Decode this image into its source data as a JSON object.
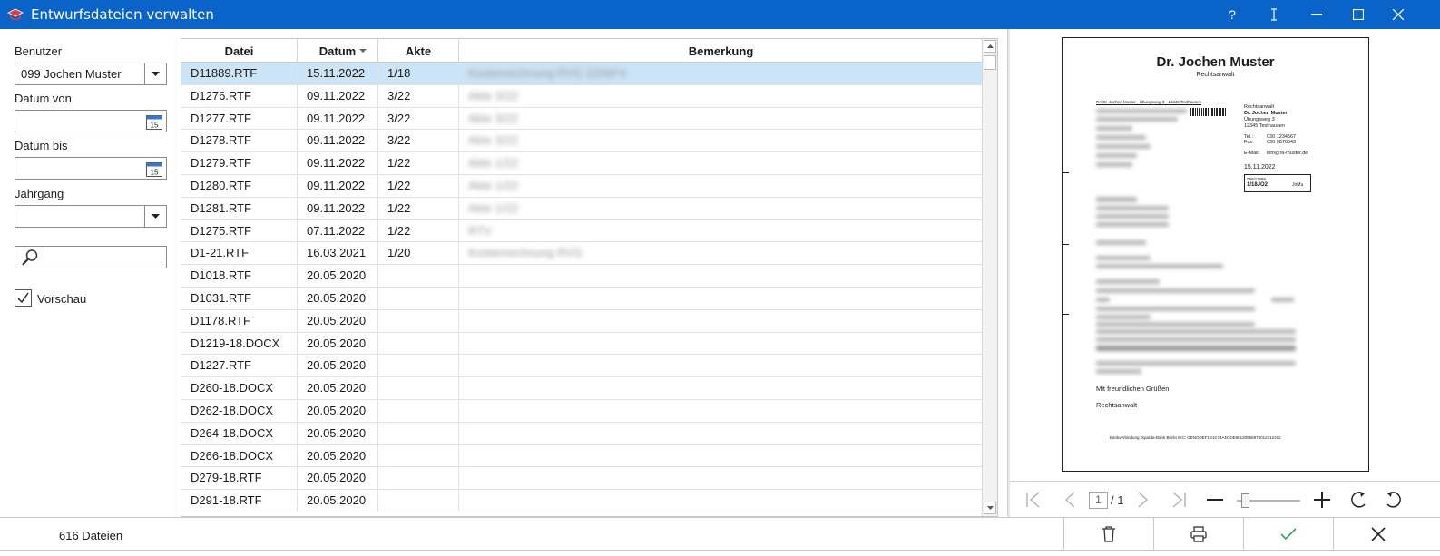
{
  "window": {
    "title": "Entwurfsdateien verwalten",
    "controls": {
      "help": "?",
      "cursor_icon": "text-cursor-icon",
      "minimize": "minimize-icon",
      "maximize": "maximize-icon",
      "close": "close-icon"
    }
  },
  "filters": {
    "user_label": "Benutzer",
    "user_value": "099 Jochen Muster",
    "date_from_label": "Datum von",
    "date_from_value": "",
    "date_to_label": "Datum bis",
    "date_to_value": "",
    "year_label": "Jahrgang",
    "year_value": "",
    "search_value": "",
    "preview_label": "Vorschau",
    "preview_checked": true
  },
  "grid": {
    "columns": [
      "Datei",
      "Datum",
      "Akte",
      "Bemerkung"
    ],
    "sort_column": "Datum",
    "sort_direction": "descending",
    "rows": [
      {
        "file": "D11889.RTF",
        "date": "15.11.2022",
        "akte": "1/18",
        "remark": "Kostenrechnung RVG 2206F4",
        "selected": true
      },
      {
        "file": "D1276.RTF",
        "date": "09.11.2022",
        "akte": "3/22",
        "remark": "Akte 3/22"
      },
      {
        "file": "D1277.RTF",
        "date": "09.11.2022",
        "akte": "3/22",
        "remark": "Akte 3/22"
      },
      {
        "file": "D1278.RTF",
        "date": "09.11.2022",
        "akte": "3/22",
        "remark": "Akte 3/22"
      },
      {
        "file": "D1279.RTF",
        "date": "09.11.2022",
        "akte": "1/22",
        "remark": "Akte 1/22"
      },
      {
        "file": "D1280.RTF",
        "date": "09.11.2022",
        "akte": "1/22",
        "remark": "Akte 1/22"
      },
      {
        "file": "D1281.RTF",
        "date": "09.11.2022",
        "akte": "1/22",
        "remark": "Akte 1/22"
      },
      {
        "file": "D1275.RTF",
        "date": "07.11.2022",
        "akte": "1/22",
        "remark": "RTV"
      },
      {
        "file": "D1-21.RTF",
        "date": "16.03.2021",
        "akte": "1/20",
        "remark": "Kostenrechnung RVG"
      },
      {
        "file": "D1018.RTF",
        "date": "20.05.2020",
        "akte": "",
        "remark": ""
      },
      {
        "file": "D1031.RTF",
        "date": "20.05.2020",
        "akte": "",
        "remark": ""
      },
      {
        "file": "D1178.RTF",
        "date": "20.05.2020",
        "akte": "",
        "remark": ""
      },
      {
        "file": "D1219-18.DOCX",
        "date": "20.05.2020",
        "akte": "",
        "remark": ""
      },
      {
        "file": "D1227.RTF",
        "date": "20.05.2020",
        "akte": "",
        "remark": ""
      },
      {
        "file": "D260-18.DOCX",
        "date": "20.05.2020",
        "akte": "",
        "remark": ""
      },
      {
        "file": "D262-18.DOCX",
        "date": "20.05.2020",
        "akte": "",
        "remark": ""
      },
      {
        "file": "D264-18.DOCX",
        "date": "20.05.2020",
        "akte": "",
        "remark": ""
      },
      {
        "file": "D266-18.DOCX",
        "date": "20.05.2020",
        "akte": "",
        "remark": ""
      },
      {
        "file": "D279-18.RTF",
        "date": "20.05.2020",
        "akte": "",
        "remark": ""
      },
      {
        "file": "D291-18.RTF",
        "date": "20.05.2020",
        "akte": "",
        "remark": ""
      }
    ]
  },
  "preview": {
    "letterhead_name": "Dr. Jochen Muster",
    "letterhead_title": "Rechtsanwalt",
    "sender_line": "RA Dr. Jochen Muster · Übungsweg 3 · 12345 Testhausen",
    "contact": {
      "role": "Rechtsanwalt",
      "name": "Dr. Jochen Muster",
      "street": "Übungsweg 3",
      "city": "12345 Testhausen",
      "tel_label": "Tel.:",
      "tel": "030 1234567",
      "fax_label": "Fax:",
      "fax": "030 9876543",
      "email_label": "E-Mail:",
      "email": "info@ra-muster.de",
      "date": "15.11.2022"
    },
    "ref_box": {
      "line1": "099/11889",
      "akte": "1/18JO2",
      "initials": "JoMu"
    },
    "closing": "Mit freundlichen Grüßen",
    "signature": "Rechtsanwalt",
    "footer": "Bankverbindung:    Sparda-Bank Berlin    BIC: GENODEF1S10    IBAN: DE86120965970012312312",
    "page_current": "1",
    "page_total": "/ 1",
    "zoom_level": 0.12
  },
  "status": {
    "count_text": "616 Dateien"
  },
  "actions": [
    "trash-icon",
    "printer-icon",
    "checkmark-icon",
    "close-icon"
  ],
  "colors": {
    "titlebar": "#0a63c9",
    "selection": "#cce4f7",
    "confirm": "#2eab5a"
  }
}
